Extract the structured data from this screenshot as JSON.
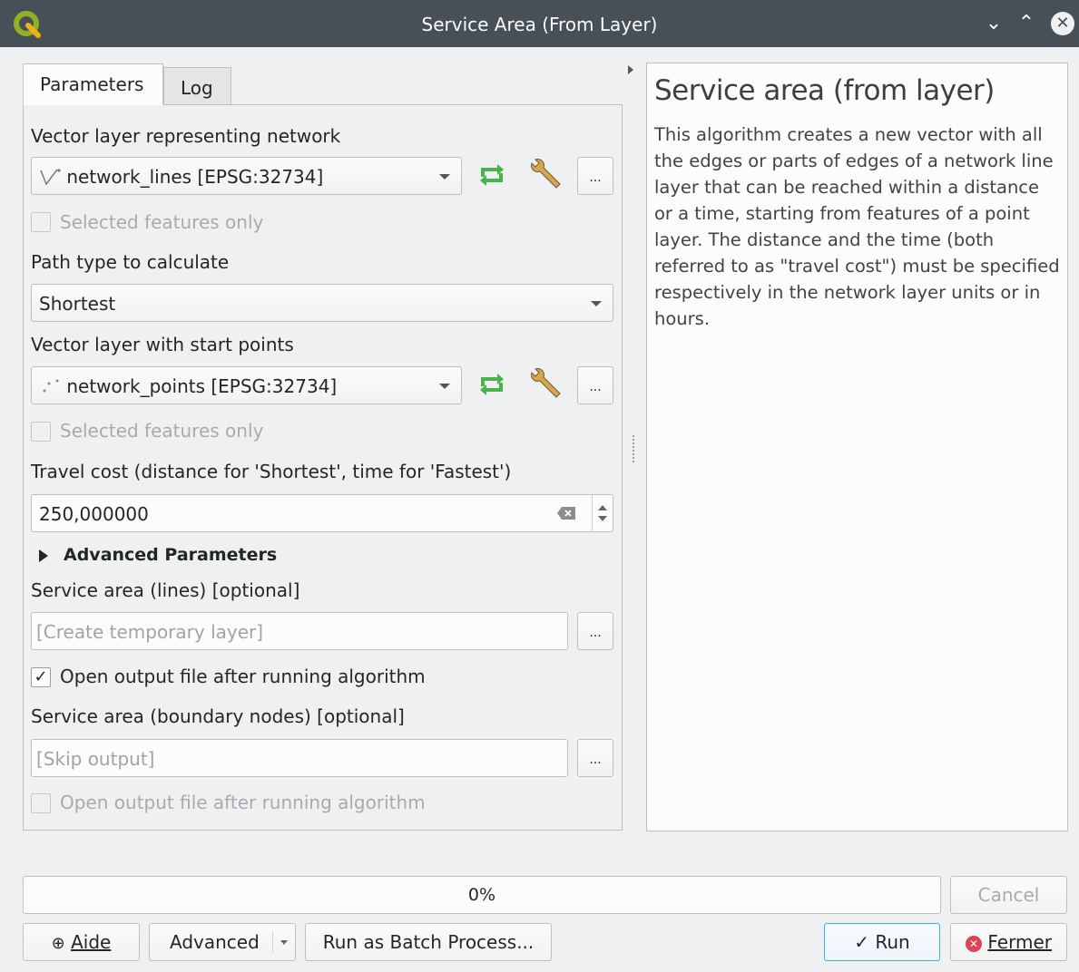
{
  "window": {
    "title": "Service Area (From Layer)"
  },
  "tabs": [
    {
      "label": "Parameters"
    },
    {
      "label": "Log"
    }
  ],
  "params": {
    "network_label": "Vector layer representing network",
    "network_value": "network_lines [EPSG:32734]",
    "selected_only_1": "Selected features only",
    "path_type_label": "Path type to calculate",
    "path_type_value": "Shortest",
    "start_points_label": "Vector layer with start points",
    "start_points_value": "network_points [EPSG:32734]",
    "selected_only_2": "Selected features only",
    "travel_cost_label": "Travel cost (distance for 'Shortest', time for 'Fastest')",
    "travel_cost_value": "250,000000",
    "advanced_label": "Advanced Parameters",
    "sa_lines_label": "Service area (lines) [optional]",
    "sa_lines_placeholder": "[Create temporary layer]",
    "open_output_1": "Open output file after running algorithm",
    "sa_nodes_label": "Service area (boundary nodes) [optional]",
    "sa_nodes_placeholder": "[Skip output]",
    "open_output_2": "Open output file after running algorithm",
    "ellipsis": "..."
  },
  "help": {
    "title": "Service area (from layer)",
    "text": "This algorithm creates a new vector with all the edges or parts of edges of a network line layer that can be reached within a distance or a time, starting from features of a point layer. The distance and the time (both referred to as \"travel cost\") must be specified respectively in the network layer units or in hours."
  },
  "footer": {
    "progress_text": "0%",
    "progress": 0,
    "cancel": "Cancel",
    "help": "Aide",
    "advanced": "Advanced",
    "batch": "Run as Batch Process...",
    "run": "Run",
    "close": "Fermer"
  },
  "colors": {
    "titlebar": "#475057",
    "accent": "#3daee9",
    "close_red": "#da4453",
    "sync_green": "#4ab44a"
  }
}
